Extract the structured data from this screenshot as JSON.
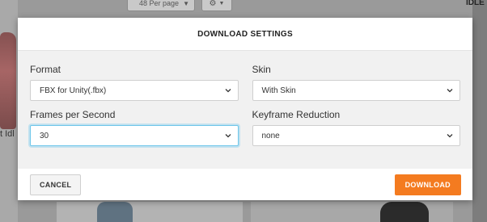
{
  "background": {
    "per_page_select": "48 Per page",
    "caption_left": "t Idl",
    "header_right": "IDLE"
  },
  "modal": {
    "title": "DOWNLOAD SETTINGS",
    "fields": {
      "format": {
        "label": "Format",
        "value": "FBX for Unity(.fbx)"
      },
      "skin": {
        "label": "Skin",
        "value": "With Skin"
      },
      "fps": {
        "label": "Frames per Second",
        "value": "30"
      },
      "keyframe": {
        "label": "Keyframe Reduction",
        "value": "none"
      }
    },
    "cancel_label": "CANCEL",
    "download_label": "DOWNLOAD"
  },
  "colors": {
    "accent": "#f47b20",
    "focus": "#6ec6ea"
  }
}
